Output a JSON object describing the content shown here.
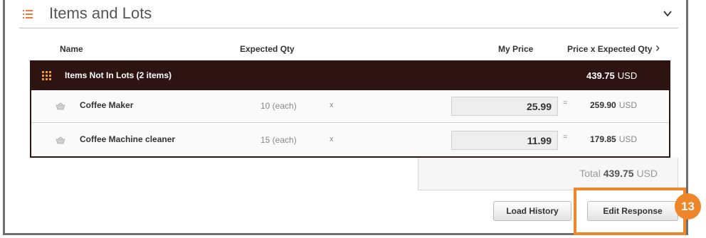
{
  "section": {
    "title": "Items and Lots"
  },
  "columns": {
    "name": "Name",
    "expected_qty": "Expected Qty",
    "my_price": "My Price",
    "price_x_qty": "Price x Expected Qty"
  },
  "group": {
    "title": "Items Not In Lots (2 items)",
    "total_value": "439.75",
    "currency": "USD"
  },
  "items": [
    {
      "name": "Coffee Maker",
      "qty": "10 (each)",
      "times": "x",
      "price": "25.99",
      "eq": "=",
      "line_total": "259.90",
      "currency": "USD"
    },
    {
      "name": "Coffee Machine cleaner",
      "qty": "15 (each)",
      "times": "x",
      "price": "11.99",
      "eq": "=",
      "line_total": "179.85",
      "currency": "USD"
    }
  ],
  "total": {
    "label": "Total",
    "value": "439.75",
    "currency": "USD"
  },
  "buttons": {
    "load_history": "Load History",
    "edit_response": "Edit Response"
  },
  "callout": {
    "number": "13"
  },
  "colors": {
    "accent": "#f0862a",
    "group_header": "#2e1313"
  },
  "icons": {
    "section": "list-icon",
    "collapse": "chevron-down-icon",
    "group": "grid-icon",
    "item": "basket-icon",
    "scroll": "chevron-right-icon"
  }
}
